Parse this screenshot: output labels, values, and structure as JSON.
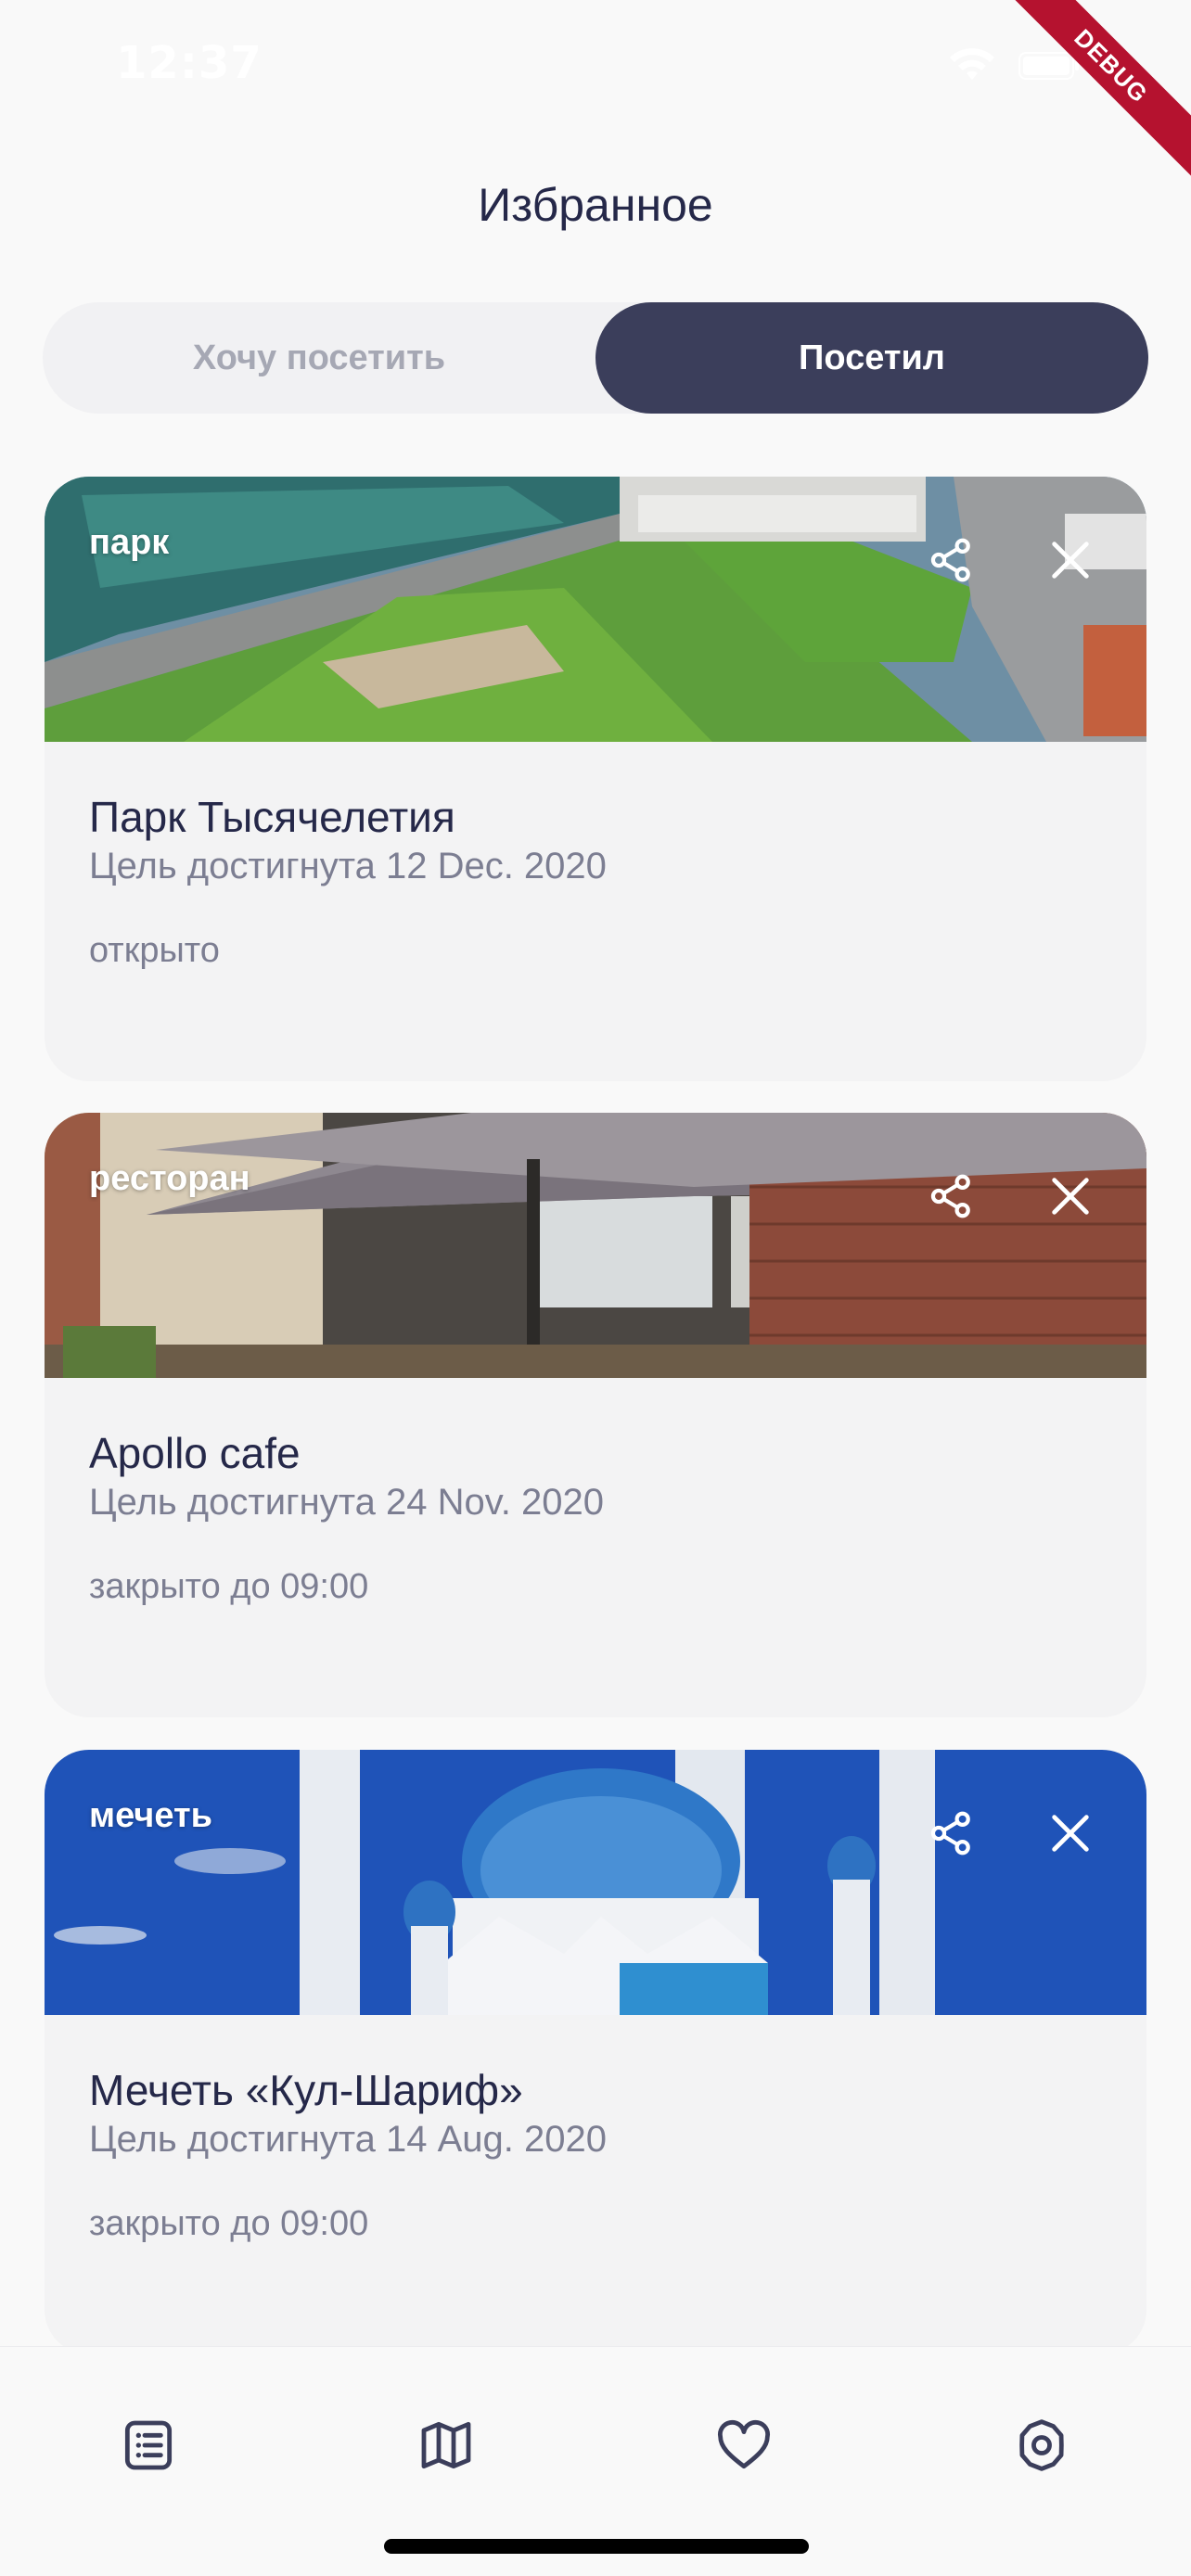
{
  "status_bar": {
    "time": "12:37"
  },
  "debug_banner": "DEBUG",
  "header": {
    "title": "Избранное"
  },
  "tabs": [
    {
      "label": "Хочу посетить",
      "active": false
    },
    {
      "label": "Посетил",
      "active": true
    }
  ],
  "cards": [
    {
      "type": "парк",
      "name": "Парк Тысячелетия",
      "visited": "Цель достигнута 12 Dec. 2020",
      "status": "открыто",
      "image": "aerial-park-photo"
    },
    {
      "type": "ресторан",
      "name": "Apollo cafe",
      "visited": "Цель достигнута 24 Nov. 2020",
      "status": "закрыто до 09:00",
      "image": "cafe-terrace-photo"
    },
    {
      "type": "мечеть",
      "name": "Мечеть «Кул-Шариф»",
      "visited": "Цель достигнута 14 Aug. 2020",
      "status": "закрыто до 09:00",
      "image": "mosque-photo"
    }
  ],
  "bottom_nav": [
    {
      "icon": "list-icon"
    },
    {
      "icon": "map-icon"
    },
    {
      "icon": "heart-icon"
    },
    {
      "icon": "settings-icon"
    }
  ],
  "colors": {
    "accent": "#3B3E5B",
    "background": "#F9F9F9",
    "card": "#F3F3F4",
    "secondary_text": "#7C7E92",
    "debug": "#B5122F"
  }
}
